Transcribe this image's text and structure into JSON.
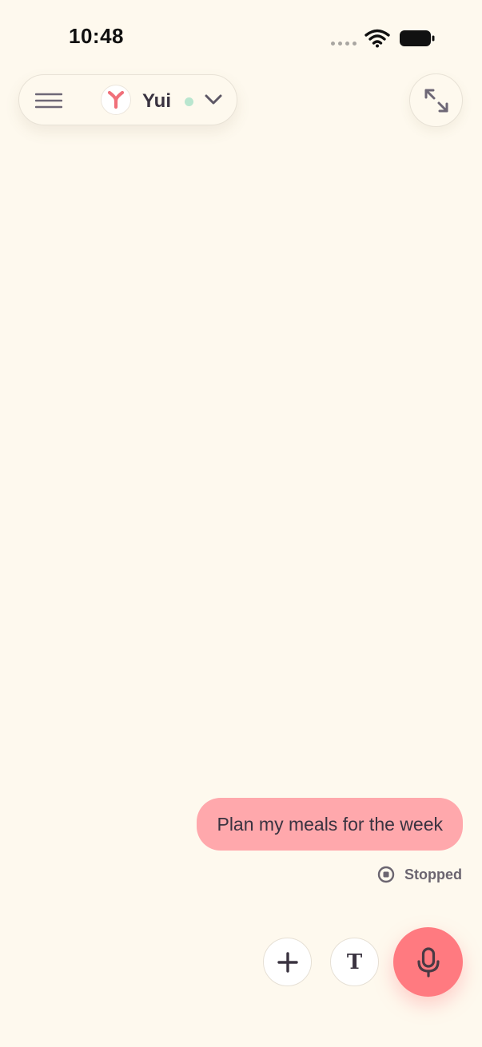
{
  "status_bar": {
    "time": "10:48"
  },
  "header": {
    "agent_name": "Yui",
    "online_color": "#b9e6cf",
    "icons": {
      "menu": "hamburger-icon",
      "avatar": "y-logo-icon",
      "dropdown": "chevron-down-icon",
      "expand": "expand-arrows-icon"
    }
  },
  "conversation": {
    "messages": [
      {
        "role": "user",
        "text": "Plan my meals for the week",
        "bubble_color": "#FFA8AC",
        "status": "Stopped"
      }
    ]
  },
  "controls": {
    "add_icon": "plus-icon",
    "text_button_glyph": "T",
    "mic_icon": "microphone-icon",
    "mic_color": "#FF7A80"
  },
  "theme": {
    "background": "#FEF9EE",
    "text": "#3a3340",
    "accent": "#F0707A"
  }
}
